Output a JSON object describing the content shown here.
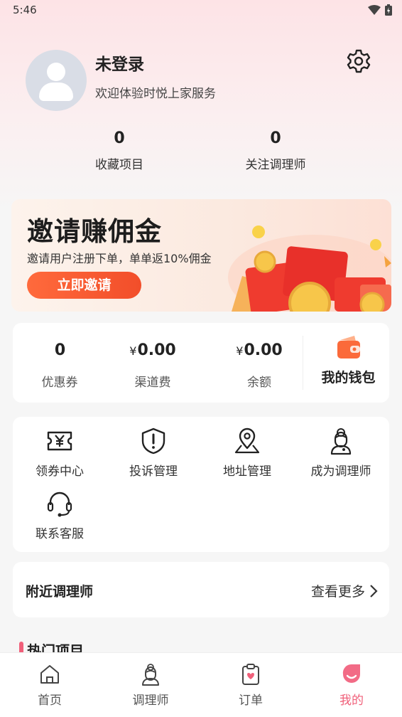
{
  "status": {
    "time": "5:46"
  },
  "profile": {
    "name": "未登录",
    "subtitle": "欢迎体验时悦上家服务",
    "stats": [
      {
        "value": "0",
        "label": "收藏项目"
      },
      {
        "value": "0",
        "label": "关注调理师"
      }
    ]
  },
  "banner": {
    "title": "邀请赚佣金",
    "subtitle": "邀请用户注册下单，单单返10%佣金",
    "button": "立即邀请"
  },
  "wallet": {
    "items": [
      {
        "currency": "",
        "value": "0",
        "label": "优惠券"
      },
      {
        "currency": "¥",
        "value": "0.00",
        "label": "渠道费"
      },
      {
        "currency": "¥",
        "value": "0.00",
        "label": "余额"
      }
    ],
    "link_label": "我的钱包"
  },
  "menu": {
    "items": [
      {
        "label": "领券中心",
        "icon": "coupon-icon"
      },
      {
        "label": "投诉管理",
        "icon": "shield-alert-icon"
      },
      {
        "label": "地址管理",
        "icon": "location-pin-icon"
      },
      {
        "label": "成为调理师",
        "icon": "therapist-icon"
      },
      {
        "label": "联系客服",
        "icon": "headset-icon"
      }
    ]
  },
  "nearby": {
    "title": "附近调理师",
    "more": "查看更多"
  },
  "hot": {
    "title": "热门项目"
  },
  "tabbar": {
    "items": [
      {
        "label": "首页",
        "icon": "home-icon"
      },
      {
        "label": "调理师",
        "icon": "therapist-icon"
      },
      {
        "label": "订单",
        "icon": "clipboard-icon"
      },
      {
        "label": "我的",
        "icon": "profile-icon"
      }
    ],
    "active_index": 3
  },
  "colors": {
    "accent": "#f0607a",
    "button": "#f24e2a",
    "header_bg": "#fde3e6"
  }
}
